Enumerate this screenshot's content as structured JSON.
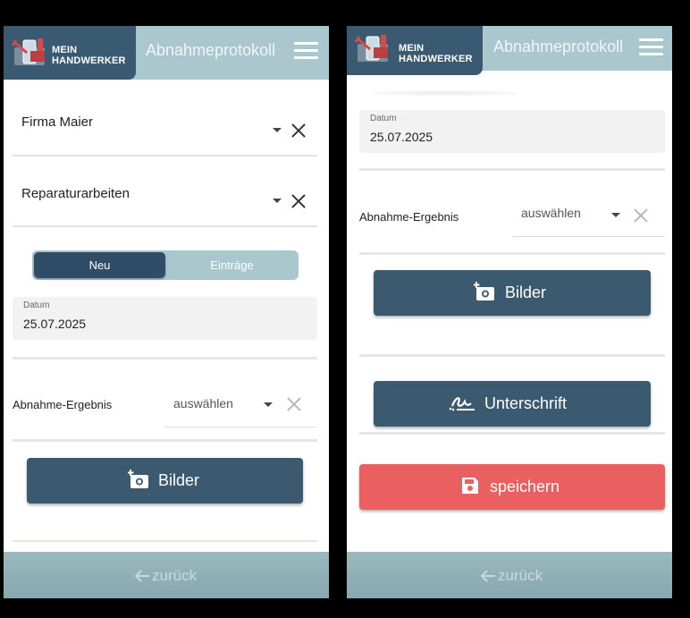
{
  "app": {
    "logo_line1": "MEIN",
    "logo_line2": "HANDWERKER",
    "title": "Abnahmeprotokoll"
  },
  "colors": {
    "header_bg": "#a9c7cd",
    "brand_dark": "#3a5a72",
    "button_dark": "#3b5a70",
    "save_red": "#ea5f5f"
  },
  "left": {
    "company": "Firma Maier",
    "category": "Reparaturarbeiten",
    "tabs": [
      {
        "label": "Neu",
        "active": true
      },
      {
        "label": "Einträge",
        "active": false
      }
    ],
    "date_label": "Datum",
    "date_value": "25.07.2025",
    "result_label": "Abnahme-Ergebnis",
    "result_value": "auswählen",
    "pictures_button": "Bilder",
    "back_label": "zurück"
  },
  "right": {
    "date_label": "Datum",
    "date_value": "25.07.2025",
    "result_label": "Abnahme-Ergebnis",
    "result_value": "auswählen",
    "pictures_button": "Bilder",
    "signature_button": "Unterschrift",
    "save_button": "speichern",
    "back_label": "zurück"
  },
  "icons": [
    "logo-icon",
    "menu-icon",
    "chevron-down-icon",
    "close-icon",
    "add-photo-icon",
    "signature-icon",
    "save-icon",
    "arrow-left-icon"
  ]
}
